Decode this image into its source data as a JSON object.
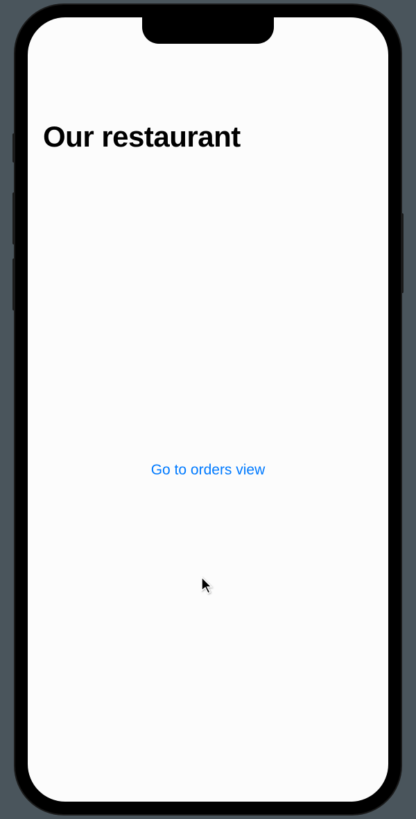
{
  "header": {
    "title": "Our restaurant"
  },
  "main": {
    "link_label": "Go to orders view"
  }
}
